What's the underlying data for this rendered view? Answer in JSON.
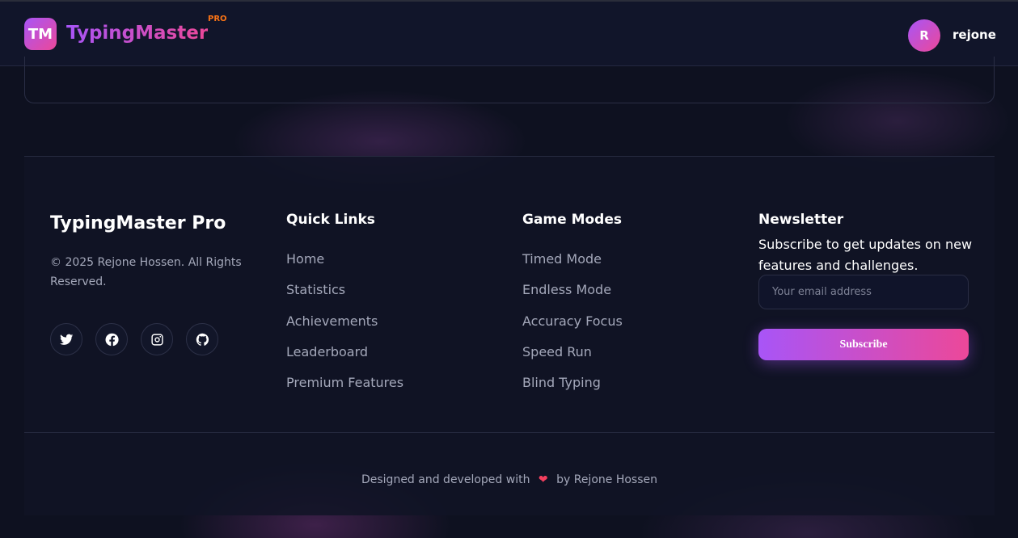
{
  "header": {
    "logo_mark": "TM",
    "logo_text": "TypingMaster",
    "logo_badge": "PRO",
    "user_initial": "R",
    "username": "rejone"
  },
  "footer": {
    "brand": {
      "title": "TypingMaster Pro",
      "copyright": "© 2025 Rejone Hossen. All Rights Reserved.",
      "socials": [
        "twitter-icon",
        "facebook-icon",
        "instagram-icon",
        "github-icon"
      ]
    },
    "quick_links": {
      "title": "Quick Links",
      "items": [
        "Home",
        "Statistics",
        "Achievements",
        "Leaderboard",
        "Premium Features"
      ]
    },
    "game_modes": {
      "title": "Game Modes",
      "items": [
        "Timed Mode",
        "Endless Mode",
        "Accuracy Focus",
        "Speed Run",
        "Blind Typing"
      ]
    },
    "newsletter": {
      "title": "Newsletter",
      "description": "Subscribe to get updates on new features and challenges.",
      "placeholder": "Your email address",
      "button_label": "Subscribe"
    },
    "credit": {
      "prefix": "Designed and developed with",
      "suffix": "by Rejone Hossen"
    }
  },
  "colors": {
    "accent_start": "#a855f7",
    "accent_end": "#ec4899",
    "badge": "#f97316",
    "background": "#0e1120"
  }
}
